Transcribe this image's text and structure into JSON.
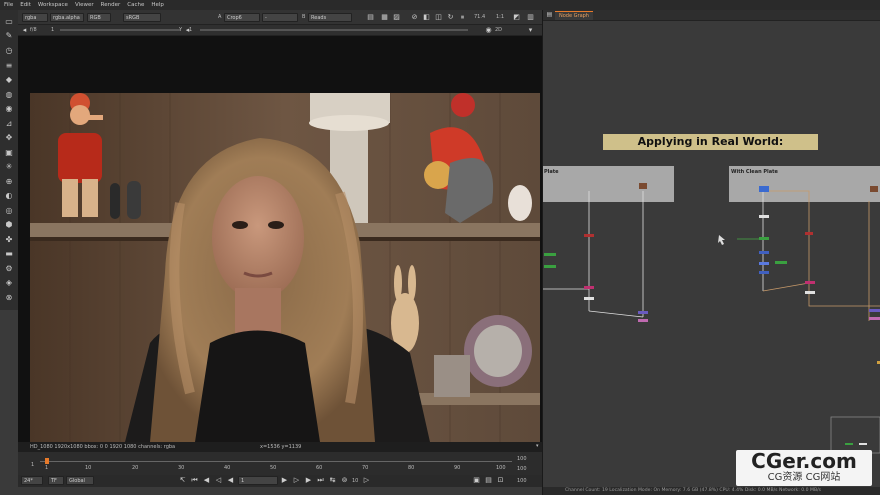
{
  "menu": [
    "File",
    "Edit",
    "Workspace",
    "Viewer",
    "Render",
    "Cache",
    "Help"
  ],
  "viewer_toolbar": {
    "channels": "rgba",
    "alpha": "rgba.alpha",
    "colorspace_label": "RGB",
    "colorspace": "sRGB",
    "input_a_label": "A",
    "input_a": "Crop6",
    "input_b_label": "B",
    "input_b": "Reads",
    "zoom": "71.4",
    "ratio": "1:1"
  },
  "viewer_toolbar2": {
    "fstop": "f/8",
    "fstop_value": "1",
    "y_label": "Y",
    "y_value": "1",
    "view_mode": "2D"
  },
  "info_bar": {
    "format": "HD_1080 1920x1080  bbox: 0 0 1920 1080 channels: rgba",
    "coords": "x=1536 y=1139"
  },
  "timeline": {
    "ticks": [
      "1",
      "10",
      "20",
      "30",
      "40",
      "50",
      "60",
      "70",
      "80",
      "90",
      "100"
    ],
    "start": "1",
    "end": "100",
    "end2": "100"
  },
  "controls": {
    "fps": "24*",
    "mode": "TF",
    "scope": "Global",
    "frame": "1",
    "step": "10",
    "end": "100"
  },
  "node_graph": {
    "tab": "Node Graph",
    "sticky_note": "Applying in Real World:",
    "backdrop1": "Plate",
    "backdrop2": "With Clean Plate"
  },
  "status": "Channel Count: 19  Localization Mode: On  Memory: 7.6 GB (47.8%)  CPU: 4.4%  Disk: 0.0 MB/s  Network: 0.0 MB/s",
  "watermark": {
    "main": "CGer.com",
    "sub": "CG资源 CG网站"
  },
  "colors": {
    "sticky": "#cfc08a",
    "backdrop": "#a8a8a8",
    "panel_bg": "#3a3a3a",
    "accent_orange": "#e87a2a"
  }
}
